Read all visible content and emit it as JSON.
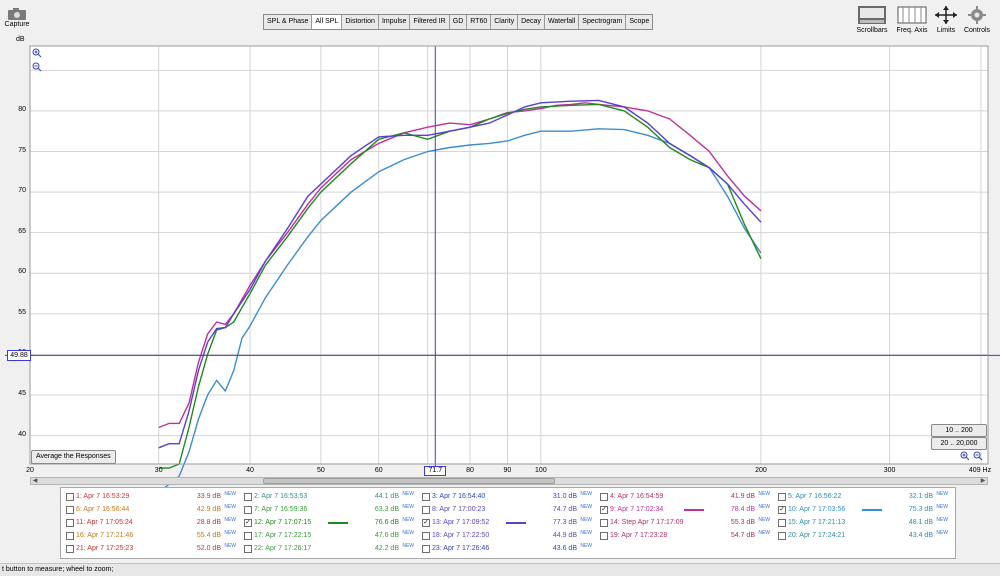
{
  "toolbar": {
    "capture": {
      "label": "Capture",
      "icon": "camera-icon"
    },
    "y_unit": "dB",
    "tabs": [
      {
        "label": "SPL & Phase",
        "active": false
      },
      {
        "label": "All SPL",
        "active": true
      },
      {
        "label": "Distortion",
        "active": false
      },
      {
        "label": "Impulse",
        "active": false
      },
      {
        "label": "Filtered IR",
        "active": false
      },
      {
        "label": "GD",
        "active": false
      },
      {
        "label": "RT60",
        "active": false
      },
      {
        "label": "Clarity",
        "active": false
      },
      {
        "label": "Decay",
        "active": false
      },
      {
        "label": "Waterfall",
        "active": false
      },
      {
        "label": "Spectrogram",
        "active": false
      },
      {
        "label": "Scope",
        "active": false
      }
    ],
    "right": [
      {
        "label": "Scrollbars",
        "icon": "scrollbars-icon"
      },
      {
        "label": "Freq. Axis",
        "icon": "freq-axis-icon"
      },
      {
        "label": "Limits",
        "icon": "limits-icon"
      },
      {
        "label": "Controls",
        "icon": "gear-icon"
      }
    ]
  },
  "plot": {
    "cursor_y_value": "49.88",
    "cursor_x_value": "71.7",
    "x_unit_label": "409 Hz",
    "average_button": "Average the Responses",
    "range_buttons": [
      "10 .. 200",
      "20 .. 20,000"
    ]
  },
  "chart_data": {
    "type": "line",
    "xscale": "log",
    "xlim": [
      20,
      409
    ],
    "ylim": [
      36.5,
      88
    ],
    "x_tick_labels": [
      "20",
      "30",
      "40",
      "50",
      "60",
      "70",
      "80",
      "90",
      "100",
      "200",
      "300"
    ],
    "x_tick_values": [
      20,
      30,
      40,
      50,
      60,
      70,
      80,
      90,
      100,
      200,
      300
    ],
    "y_tick_labels": [
      "80",
      "75",
      "70",
      "65",
      "60",
      "55",
      "50",
      "45",
      "40"
    ],
    "y_tick_values": [
      80,
      75,
      70,
      65,
      60,
      55,
      50,
      45,
      40
    ],
    "grid": true,
    "cursor": {
      "x": 71.7,
      "y": 49.88
    },
    "series": [
      {
        "name": "9: Apr 7 17:02:34",
        "color": "#c0309a",
        "points": [
          [
            30,
            41
          ],
          [
            31,
            41.5
          ],
          [
            32,
            41.5
          ],
          [
            33,
            44
          ],
          [
            34,
            49
          ],
          [
            35,
            52.5
          ],
          [
            36,
            54
          ],
          [
            37,
            53.7
          ],
          [
            38,
            55
          ],
          [
            40,
            58.5
          ],
          [
            42,
            61.5
          ],
          [
            45,
            65
          ],
          [
            48,
            68.5
          ],
          [
            50,
            70.5
          ],
          [
            55,
            74
          ],
          [
            60,
            76
          ],
          [
            65,
            77.3
          ],
          [
            70,
            78
          ],
          [
            75,
            78.5
          ],
          [
            80,
            78.3
          ],
          [
            85,
            79
          ],
          [
            90,
            79.8
          ],
          [
            95,
            80
          ],
          [
            100,
            80.3
          ],
          [
            105,
            80.7
          ],
          [
            110,
            80.8
          ],
          [
            115,
            81
          ],
          [
            120,
            80.8
          ],
          [
            130,
            80.5
          ],
          [
            140,
            80
          ],
          [
            150,
            79
          ],
          [
            160,
            77
          ],
          [
            170,
            75
          ],
          [
            180,
            72
          ],
          [
            190,
            69.5
          ],
          [
            200,
            67.7
          ]
        ]
      },
      {
        "name": "10: Apr 7 17:03:56",
        "color": "#3c8cd0",
        "points": [
          [
            30,
            33
          ],
          [
            32,
            35
          ],
          [
            33,
            38
          ],
          [
            34,
            42
          ],
          [
            35,
            45
          ],
          [
            36,
            46.8
          ],
          [
            37,
            45.5
          ],
          [
            38,
            48
          ],
          [
            39,
            52
          ],
          [
            40,
            53.5
          ],
          [
            42,
            57
          ],
          [
            45,
            61
          ],
          [
            48,
            64.5
          ],
          [
            50,
            66.5
          ],
          [
            55,
            70
          ],
          [
            60,
            72.5
          ],
          [
            65,
            74
          ],
          [
            70,
            75
          ],
          [
            75,
            75.5
          ],
          [
            80,
            75.8
          ],
          [
            85,
            76
          ],
          [
            90,
            76.3
          ],
          [
            95,
            77
          ],
          [
            100,
            77.5
          ],
          [
            110,
            77.5
          ],
          [
            120,
            77.8
          ],
          [
            130,
            77.7
          ],
          [
            140,
            77
          ],
          [
            150,
            76
          ],
          [
            160,
            74.5
          ],
          [
            170,
            73
          ],
          [
            180,
            69.5
          ],
          [
            190,
            65.5
          ],
          [
            200,
            62.5
          ]
        ]
      },
      {
        "name": "12: Apr 7 17:07:15",
        "color": "#1f8a1f",
        "points": [
          [
            30,
            36
          ],
          [
            31,
            36
          ],
          [
            32,
            36.5
          ],
          [
            33,
            41
          ],
          [
            34,
            46
          ],
          [
            35,
            50
          ],
          [
            36,
            53
          ],
          [
            37,
            53.3
          ],
          [
            38,
            54
          ],
          [
            40,
            57.5
          ],
          [
            42,
            61
          ],
          [
            45,
            64.5
          ],
          [
            48,
            68
          ],
          [
            50,
            70
          ],
          [
            55,
            73.5
          ],
          [
            60,
            76.5
          ],
          [
            65,
            77.3
          ],
          [
            70,
            76.5
          ],
          [
            75,
            77.5
          ],
          [
            80,
            78
          ],
          [
            85,
            79
          ],
          [
            90,
            79.7
          ],
          [
            95,
            80.2
          ],
          [
            100,
            80.5
          ],
          [
            110,
            80.7
          ],
          [
            120,
            80.8
          ],
          [
            130,
            80
          ],
          [
            140,
            78
          ],
          [
            150,
            75.5
          ],
          [
            160,
            74
          ],
          [
            170,
            73
          ],
          [
            180,
            71
          ],
          [
            190,
            66
          ],
          [
            200,
            61.8
          ]
        ]
      },
      {
        "name": "13: Apr 7 17:09:52",
        "color": "#5a3fd0",
        "points": [
          [
            30,
            38.5
          ],
          [
            31,
            39
          ],
          [
            32,
            39
          ],
          [
            33,
            43
          ],
          [
            34,
            48
          ],
          [
            35,
            51.5
          ],
          [
            36,
            53.2
          ],
          [
            37,
            53.3
          ],
          [
            38,
            55
          ],
          [
            40,
            58
          ],
          [
            42,
            61.5
          ],
          [
            45,
            65.5
          ],
          [
            48,
            69.5
          ],
          [
            50,
            71
          ],
          [
            55,
            74.5
          ],
          [
            60,
            76.8
          ],
          [
            65,
            77
          ],
          [
            70,
            77
          ],
          [
            75,
            77.5
          ],
          [
            80,
            78
          ],
          [
            85,
            78.5
          ],
          [
            90,
            79.5
          ],
          [
            95,
            80.5
          ],
          [
            100,
            81
          ],
          [
            110,
            81.2
          ],
          [
            120,
            81.3
          ],
          [
            130,
            80.5
          ],
          [
            140,
            78.5
          ],
          [
            150,
            76
          ],
          [
            160,
            74.5
          ],
          [
            170,
            73
          ],
          [
            180,
            71
          ],
          [
            190,
            68.5
          ],
          [
            200,
            66.3
          ]
        ]
      }
    ]
  },
  "measurements": [
    {
      "name": "1: Apr 7 16:53:29",
      "value": "33.9 dB",
      "color": "#c83232",
      "checked": false
    },
    {
      "name": "2: Apr 7 16:53:53",
      "value": "44.1 dB",
      "color": "#3c8c8c",
      "checked": false
    },
    {
      "name": "3: Apr 7 16:54:40",
      "value": "31.0 dB",
      "color": "#2b4aa8",
      "checked": false
    },
    {
      "name": "4: Apr 7 16:54:59",
      "value": "41.9 dB",
      "color": "#a8306e",
      "checked": false
    },
    {
      "name": "5: Apr 7 16:56:22",
      "value": "32.1 dB",
      "color": "#2f8aa8",
      "checked": false
    },
    {
      "name": "6: Apr 7 16:56:44",
      "value": "42.9 dB",
      "color": "#c0781e",
      "checked": false
    },
    {
      "name": "7: Apr 7 16:59:36",
      "value": "63.3 dB",
      "color": "#3a9a3a",
      "checked": false
    },
    {
      "name": "8: Apr 7 17:00:23",
      "value": "74.7 dB",
      "color": "#5a4ab8",
      "checked": false
    },
    {
      "name": "9: Apr 7 17:02:34",
      "value": "78.4 dB",
      "color": "#c0309a",
      "checked": true
    },
    {
      "name": "10: Apr 7 17:03:56",
      "value": "75.3 dB",
      "color": "#3c8cd0",
      "checked": true
    },
    {
      "name": "11: Apr 7 17:05:24",
      "value": "28.8 dB",
      "color": "#c83232",
      "checked": false
    },
    {
      "name": "12: Apr 7 17:07:15",
      "value": "76.6 dB",
      "color": "#1f8a1f",
      "checked": true
    },
    {
      "name": "13: Apr 7 17:09:52",
      "value": "77.3 dB",
      "color": "#5a3fd0",
      "checked": true
    },
    {
      "name": "14: Step Apr 7 17:17:09",
      "value": "55.3 dB",
      "color": "#a8306e",
      "checked": false
    },
    {
      "name": "15: Apr 7 17:21:13",
      "value": "48.1 dB",
      "color": "#2f8aa8",
      "checked": false
    },
    {
      "name": "16: Apr 7 17:21:46",
      "value": "55.4 dB",
      "color": "#c0781e",
      "checked": false
    },
    {
      "name": "17: Apr 7 17:22:15",
      "value": "47.6 dB",
      "color": "#3a9a3a",
      "checked": false
    },
    {
      "name": "18: Apr 7 17:22:50",
      "value": "44.9 dB",
      "color": "#5a4ab8",
      "checked": false
    },
    {
      "name": "19: Apr 7 17:23:28",
      "value": "54.7 dB",
      "color": "#a8306e",
      "checked": false
    },
    {
      "name": "20: Apr 7 17:24:21",
      "value": "43.4 dB",
      "color": "#2f8aa8",
      "checked": false
    },
    {
      "name": "21: Apr 7 17:25:23",
      "value": "52.0 dB",
      "color": "#c83232",
      "checked": false
    },
    {
      "name": "22: Apr 7 17:26:17",
      "value": "42.2 dB",
      "color": "#3a9a3a",
      "checked": false
    },
    {
      "name": "23: Apr 7 17:26:46",
      "value": "43.6 dB",
      "color": "#2b4aa8",
      "checked": false
    }
  ],
  "new_badge": "NEW",
  "status_text": "t button to measure; wheel to zoom;"
}
